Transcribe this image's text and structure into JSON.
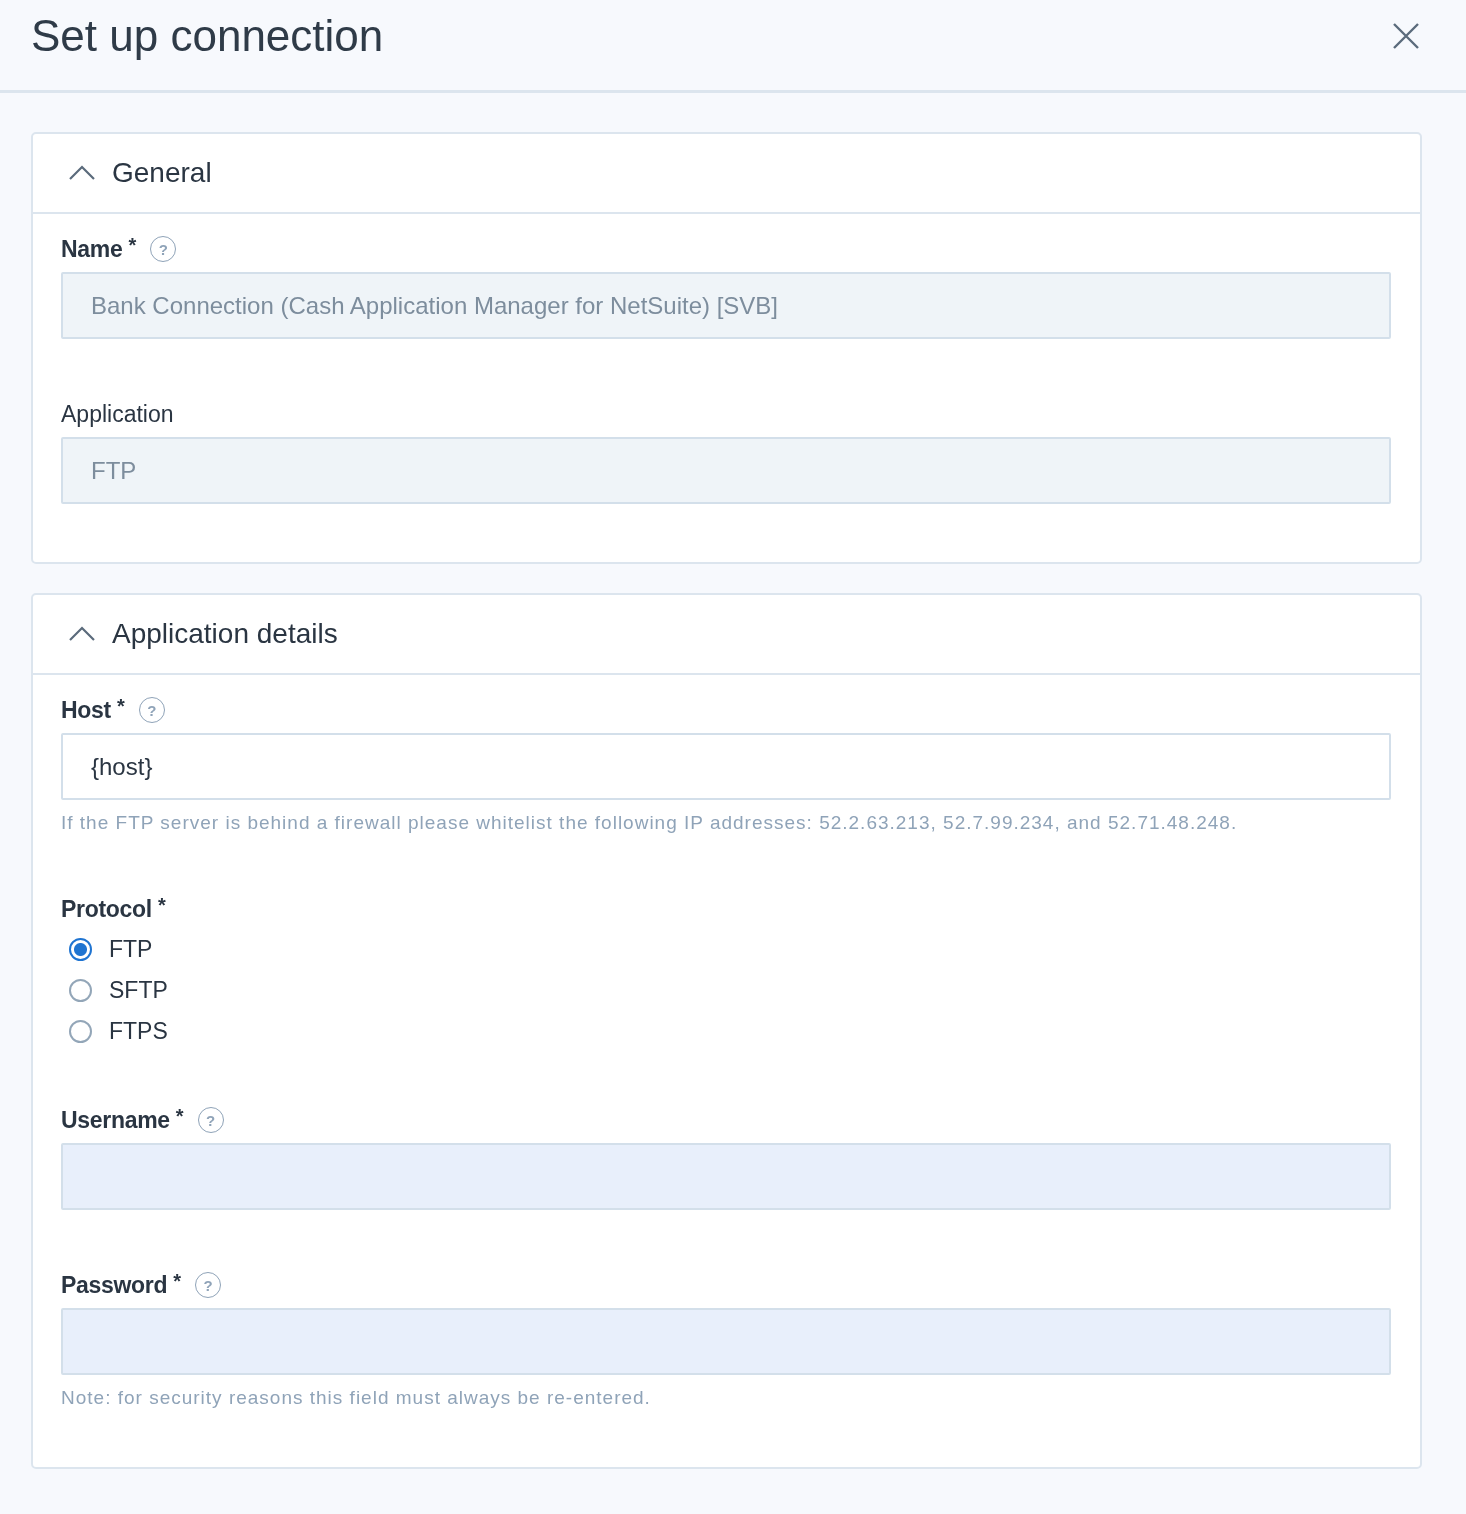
{
  "window": {
    "title": "Set up connection"
  },
  "sections": [
    {
      "title": "General",
      "expanded": true,
      "fields": [
        {
          "kind": "text",
          "label": "Name",
          "required_mark": "*",
          "help": "?",
          "value": "Bank Connection (Cash Application Manager for NetSuite) [SVB]",
          "disabled": true
        },
        {
          "kind": "text",
          "label": "Application",
          "value": "FTP",
          "disabled": true
        }
      ]
    },
    {
      "title": "Application details",
      "expanded": true,
      "fields": [
        {
          "kind": "text",
          "label": "Host",
          "required_mark": "*",
          "help": "?",
          "value": "{host}",
          "disabled": false,
          "autofilled": false,
          "hint": "If the FTP server is behind a firewall please whitelist the following IP addresses: 52.2.63.213, 52.7.99.234, and 52.71.48.248."
        },
        {
          "kind": "radio",
          "label": "Protocol",
          "required_mark": "*",
          "options": [
            {
              "label": "FTP",
              "selected": true
            },
            {
              "label": "SFTP",
              "selected": false
            },
            {
              "label": "FTPS",
              "selected": false
            }
          ]
        },
        {
          "kind": "text",
          "label": "Username",
          "required_mark": "*",
          "help": "?",
          "disabled": false,
          "autofilled": true
        },
        {
          "kind": "password",
          "label": "Password",
          "required_mark": "*",
          "help": "?",
          "disabled": false,
          "autofilled": true,
          "hint": "Note: for security reasons this field must always be re-entered."
        }
      ]
    }
  ]
}
